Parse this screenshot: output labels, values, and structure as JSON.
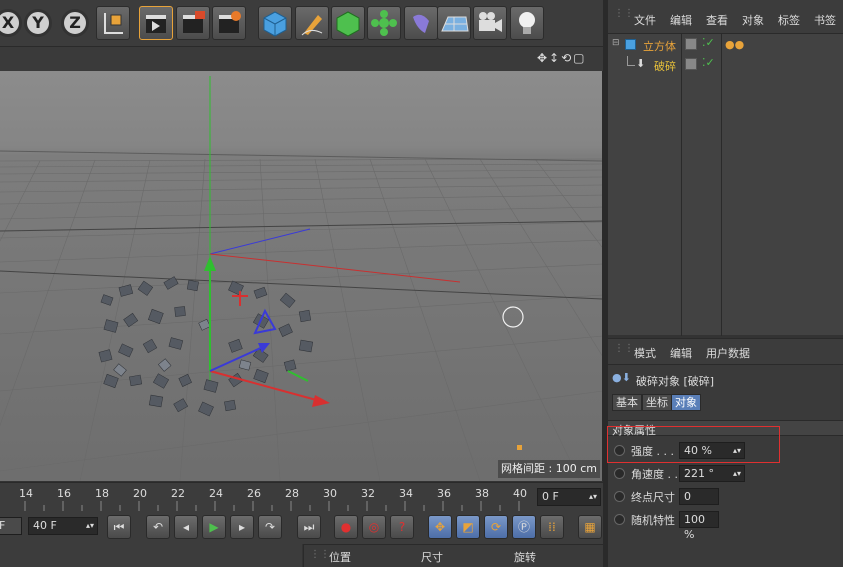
{
  "toolbar": {
    "x_label": "X",
    "y_label": "Y",
    "z_label": "Z",
    "icons": [
      "coordinate-system-icon",
      "render-view-icon",
      "render-picture-viewer-icon",
      "render-settings-icon",
      "cube-icon",
      "pen-icon",
      "subdivision-icon",
      "cloner-icon",
      "deformer-icon",
      "floor-icon",
      "camera-icon",
      "light-icon"
    ]
  },
  "viewport": {
    "grid_spacing_label": "网格间距 : 100 cm"
  },
  "object_manager": {
    "menu": [
      "文件",
      "编辑",
      "查看",
      "对象",
      "标签",
      "书签"
    ],
    "objects": [
      {
        "name": "立方体",
        "color": "#e8a33a"
      },
      {
        "name": "破碎",
        "color": "#e8c23a"
      }
    ]
  },
  "attribute_manager": {
    "menu": [
      "模式",
      "编辑",
      "用户数据"
    ],
    "object_title": "破碎对象 [破碎]",
    "tabs": [
      "基本",
      "坐标",
      "对象"
    ],
    "active_tab": "对象",
    "section": "对象属性",
    "properties": [
      {
        "label": "强度 . . .",
        "value": "40 %"
      },
      {
        "label": "角速度 . .",
        "value": "221 °"
      },
      {
        "label": "终点尺寸",
        "value": "0"
      },
      {
        "label": "随机特性",
        "value": "100 %"
      }
    ]
  },
  "timeline": {
    "ticks": [
      "14",
      "16",
      "18",
      "20",
      "22",
      "24",
      "26",
      "28",
      "30",
      "32",
      "34",
      "36",
      "38",
      "40"
    ],
    "current_frame": "0 F",
    "end_frame": "40 F",
    "start_frame": "F"
  },
  "coords": {
    "headers": [
      "位置",
      "尺寸",
      "旋转"
    ]
  },
  "colors": {
    "accent": "#e8a33a",
    "highlight": "#5a7fb8",
    "annotation": "#e03030"
  }
}
